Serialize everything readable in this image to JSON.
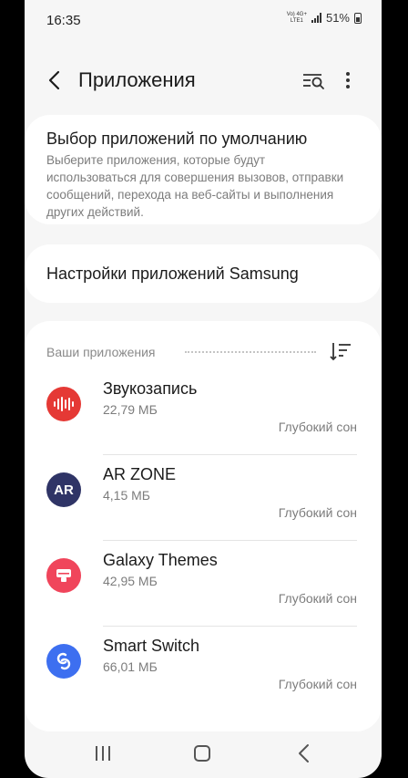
{
  "status_bar": {
    "time": "16:35",
    "network_top": "Vo) 4G+",
    "network_bottom": "LTE1",
    "battery": "51%"
  },
  "app_bar": {
    "title": "Приложения",
    "back_icon": "back-arrow-icon",
    "search_icon": "list-search-icon",
    "more_icon": "more-vert-icon"
  },
  "default_apps": {
    "title": "Выбор приложений по умолчанию",
    "description": "Выберите приложения, которые будут использоваться для совершения вызовов, отправки сообщений, перехода на веб-сайты и выполнения других действий."
  },
  "samsung_settings": {
    "title": "Настройки приложений Samsung"
  },
  "your_apps": {
    "label": "Ваши приложения",
    "apps": [
      {
        "name": "Звукозапись",
        "size": "22,79 МБ",
        "state": "Глубокий сон",
        "icon": "voice-recorder-icon",
        "color": "#e53935"
      },
      {
        "name": "AR ZONE",
        "size": "4,15 МБ",
        "state": "Глубокий сон",
        "icon": "ar-zone-icon",
        "color": "#2f3466",
        "icon_text": "AR"
      },
      {
        "name": "Galaxy Themes",
        "size": "42,95 МБ",
        "state": "Глубокий сон",
        "icon": "galaxy-themes-icon",
        "color": "#f0455b"
      },
      {
        "name": "Smart Switch",
        "size": "66,01 МБ",
        "state": "Глубокий сон",
        "icon": "smart-switch-icon",
        "color": "#3d6ff0"
      }
    ]
  }
}
